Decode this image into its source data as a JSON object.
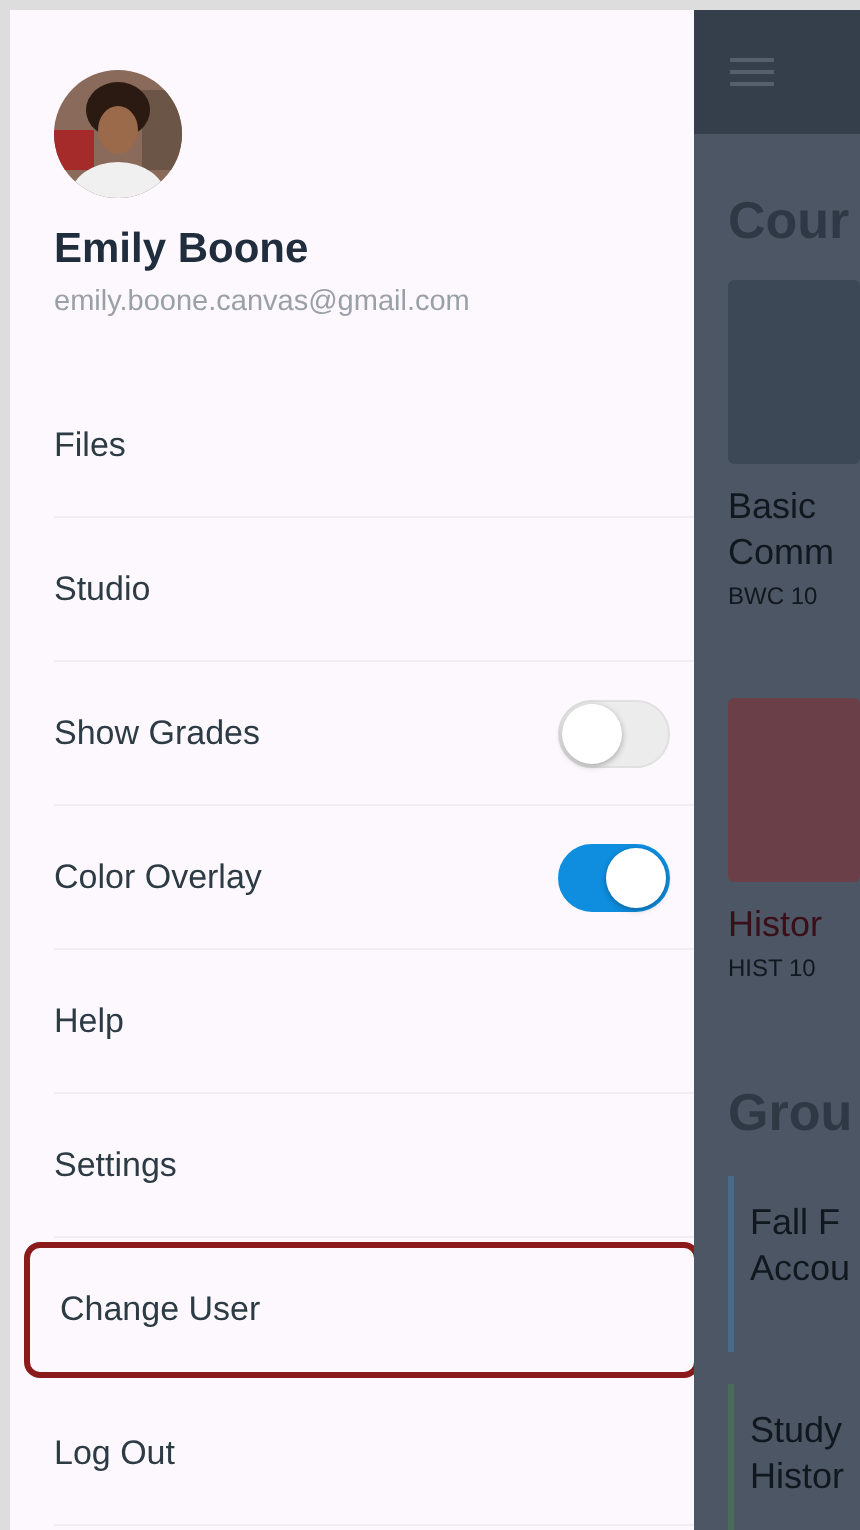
{
  "profile": {
    "name": "Emily Boone",
    "email": "emily.boone.canvas@gmail.com"
  },
  "menu": [
    {
      "kind": "link",
      "label": "Files",
      "highlighted": false
    },
    {
      "kind": "link",
      "label": "Studio",
      "highlighted": false
    },
    {
      "kind": "toggle",
      "label": "Show Grades",
      "on": false,
      "highlighted": false
    },
    {
      "kind": "toggle",
      "label": "Color Overlay",
      "on": true,
      "highlighted": false
    },
    {
      "kind": "link",
      "label": "Help",
      "highlighted": false
    },
    {
      "kind": "link",
      "label": "Settings",
      "highlighted": false
    },
    {
      "kind": "link",
      "label": "Change User",
      "highlighted": true
    },
    {
      "kind": "link",
      "label": "Log Out",
      "highlighted": false
    }
  ],
  "background": {
    "courses_heading": "Cour",
    "courses": [
      {
        "title_lines": [
          "Basic",
          "Comm"
        ],
        "code": "BWC 10",
        "color": "#3d4857"
      },
      {
        "title_lines": [
          "Histor"
        ],
        "code": "HIST 10",
        "color": "#6b3f48"
      }
    ],
    "groups_heading": "Grou",
    "groups": [
      {
        "title": "Fall F",
        "subtitle": "Accou",
        "color": "#4a6a8a"
      },
      {
        "title": "Study",
        "subtitle": "Histor",
        "color": "#4a6a5a"
      }
    ]
  }
}
